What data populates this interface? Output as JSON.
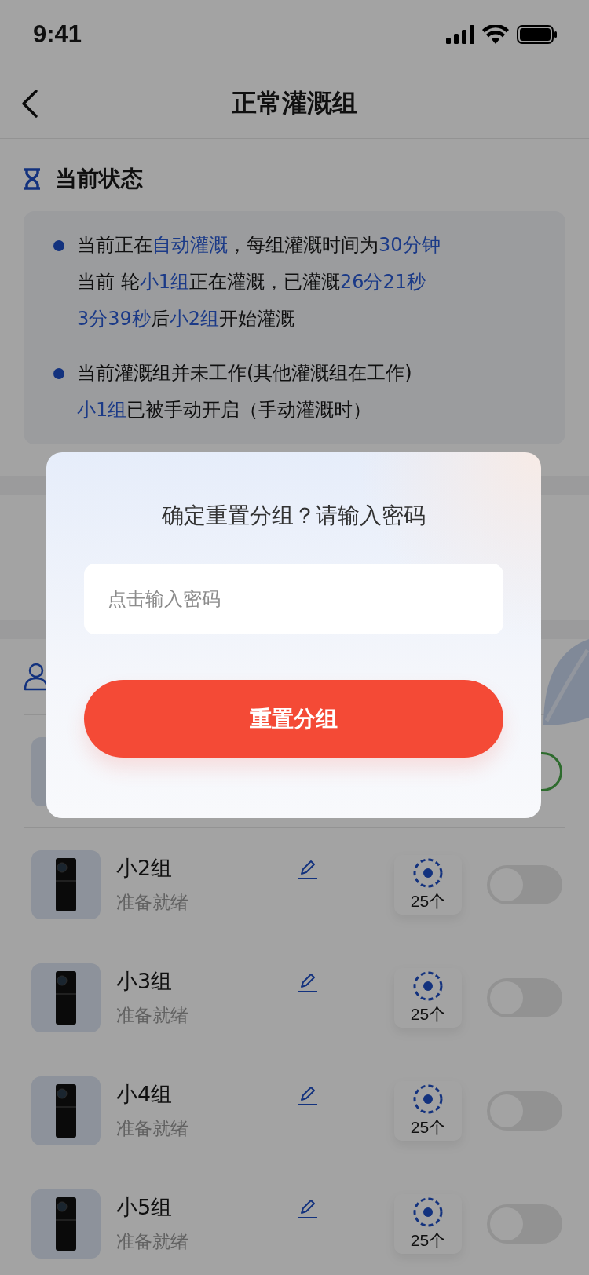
{
  "status_bar": {
    "time": "9:41"
  },
  "nav": {
    "title": "正常灌溉组"
  },
  "current_status": {
    "title": "当前状态",
    "bullets": [
      {
        "lines": [
          [
            {
              "text": "当前正在",
              "highlight": false
            },
            {
              "text": "自动灌溉",
              "highlight": true
            },
            {
              "text": "，每组灌溉时间为",
              "highlight": false
            },
            {
              "text": "30分钟",
              "highlight": true
            }
          ],
          [
            {
              "text": "当前 轮",
              "highlight": false
            },
            {
              "text": "小1组",
              "highlight": true
            },
            {
              "text": "正在灌溉，已灌溉",
              "highlight": false
            },
            {
              "text": "26分21秒",
              "highlight": true
            }
          ],
          [
            {
              "text": "3分39秒",
              "highlight": true
            },
            {
              "text": "后",
              "highlight": false
            },
            {
              "text": "小2组",
              "highlight": true
            },
            {
              "text": "开始灌溉",
              "highlight": false
            }
          ]
        ]
      },
      {
        "lines": [
          [
            {
              "text": "当前灌溉组并未工作(其他灌溉组在工作)",
              "highlight": false
            }
          ],
          [
            {
              "text": "小1组",
              "highlight": true
            },
            {
              "text": "已被手动开启（手动灌溉时）",
              "highlight": false
            }
          ]
        ]
      }
    ]
  },
  "groups": [
    {
      "on": true
    },
    {
      "name": "小2组",
      "status": "准备就绪",
      "count": "25个",
      "on": false
    },
    {
      "name": "小3组",
      "status": "准备就绪",
      "count": "25个",
      "on": false
    },
    {
      "name": "小4组",
      "status": "准备就绪",
      "count": "25个",
      "on": false
    },
    {
      "name": "小5组",
      "status": "准备就绪",
      "count": "25个",
      "on": false
    }
  ],
  "dialog": {
    "title": "确定重置分组？请输入密码",
    "placeholder": "点击输入密码",
    "button": "重置分组"
  }
}
